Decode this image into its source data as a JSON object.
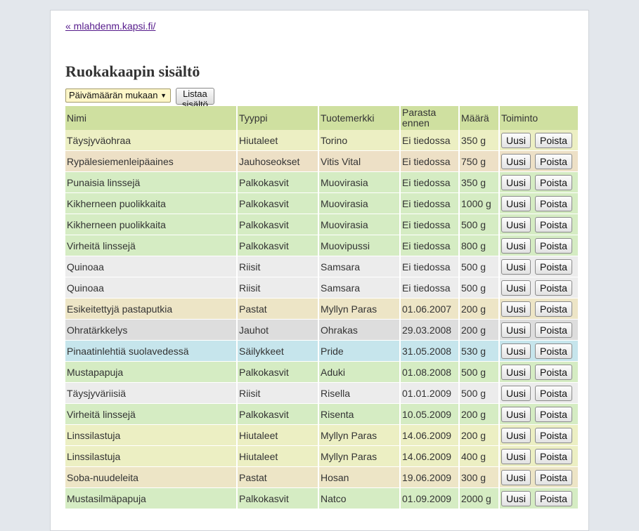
{
  "nav": {
    "back_link": "« mlahdenm.kapsi.fi/"
  },
  "page": {
    "title": "Ruokakaapin sisältö"
  },
  "controls": {
    "sort_selected": "Päivämäärän mukaan",
    "list_button": "Listaa sisältö"
  },
  "table": {
    "headers": [
      "Nimi",
      "Tyyppi",
      "Tuotemerkki",
      "Parasta ennen",
      "Määrä",
      "Toiminto"
    ],
    "new_label": "Uusi",
    "delete_label": "Poista",
    "row_colors": {
      "Hiutaleet": "#ecefc3",
      "Jauhoseokset": "#ede0c6",
      "Palkokasvit": "#d5ecc3",
      "Riisit": "#ececec",
      "Pastat": "#ede5c6",
      "Jauhot": "#dddddd",
      "Säilykkeet": "#c6e5ec"
    },
    "rows": [
      [
        "Täysjyväohraa",
        "Hiutaleet",
        "Torino",
        "Ei tiedossa",
        "350 g"
      ],
      [
        "Rypälesiemenleipäaines",
        "Jauhoseokset",
        "Vitis Vital",
        "Ei tiedossa",
        "750 g"
      ],
      [
        "Punaisia linssejä",
        "Palkokasvit",
        "Muovirasia",
        "Ei tiedossa",
        "350 g"
      ],
      [
        "Kikherneen puolikkaita",
        "Palkokasvit",
        "Muovirasia",
        "Ei tiedossa",
        "1000 g"
      ],
      [
        "Kikherneen puolikkaita",
        "Palkokasvit",
        "Muovirasia",
        "Ei tiedossa",
        "500 g"
      ],
      [
        "Virheitä linssejä",
        "Palkokasvit",
        "Muovipussi",
        "Ei tiedossa",
        "800 g"
      ],
      [
        "Quinoaa",
        "Riisit",
        "Samsara",
        "Ei tiedossa",
        "500 g"
      ],
      [
        "Quinoaa",
        "Riisit",
        "Samsara",
        "Ei tiedossa",
        "500 g"
      ],
      [
        "Esikeitettyjä pastaputkia",
        "Pastat",
        "Myllyn Paras",
        "01.06.2007",
        "200 g"
      ],
      [
        "Ohratärkkelys",
        "Jauhot",
        "Ohrakas",
        "29.03.2008",
        "200 g"
      ],
      [
        "Pinaatinlehtiä suolavedessä",
        "Säilykkeet",
        "Pride",
        "31.05.2008",
        "530 g"
      ],
      [
        "Mustapapuja",
        "Palkokasvit",
        "Aduki",
        "01.08.2008",
        "500 g"
      ],
      [
        "Täysjyväriisiä",
        "Riisit",
        "Risella",
        "01.01.2009",
        "500 g"
      ],
      [
        "Virheitä linssejä",
        "Palkokasvit",
        "Risenta",
        "10.05.2009",
        "200 g"
      ],
      [
        "Linssilastuja",
        "Hiutaleet",
        "Myllyn Paras",
        "14.06.2009",
        "200 g"
      ],
      [
        "Linssilastuja",
        "Hiutaleet",
        "Myllyn Paras",
        "14.06.2009",
        "400 g"
      ],
      [
        "Soba-nuudeleita",
        "Pastat",
        "Hosan",
        "19.06.2009",
        "300 g"
      ],
      [
        "Mustasilmäpapuja",
        "Palkokasvit",
        "Natco",
        "01.09.2009",
        "2000 g"
      ]
    ]
  }
}
